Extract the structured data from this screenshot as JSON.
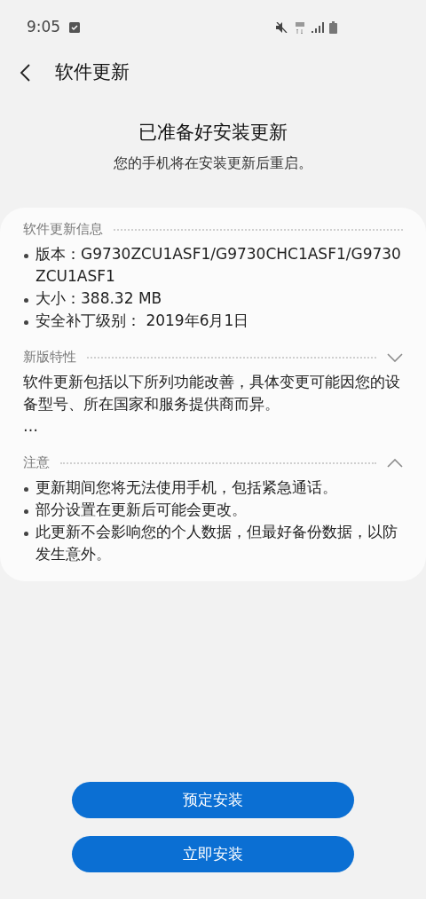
{
  "status_bar": {
    "time": "9:05"
  },
  "header": {
    "title": "软件更新"
  },
  "intro": {
    "title": "已准备好安装更新",
    "subtitle": "您的手机将在安装更新后重启。"
  },
  "sections": [
    {
      "kind": "list",
      "title": "软件更新信息",
      "items": [
        "版本：G9730ZCU1ASF1/G9730CHC1ASF1/G9730ZCU1ASF1",
        "大小：388.32 MB",
        "安全补丁级别： 2019年6月1日"
      ]
    },
    {
      "kind": "text",
      "title": "新版特性",
      "expanded": false,
      "text": "软件更新包括以下所列功能改善，具体变更可能因您的设备型号、所在国家和服务提供商而异。",
      "more": "…"
    },
    {
      "kind": "list",
      "title": "注意",
      "expanded": true,
      "items": [
        "更新期间您将无法使用手机，包括紧急通话。",
        "部分设置在更新后可能会更改。",
        "此更新不会影响您的个人数据，但最好备份数据，以防发生意外。"
      ]
    }
  ],
  "buttons": [
    "预定安装",
    "立即安装"
  ]
}
